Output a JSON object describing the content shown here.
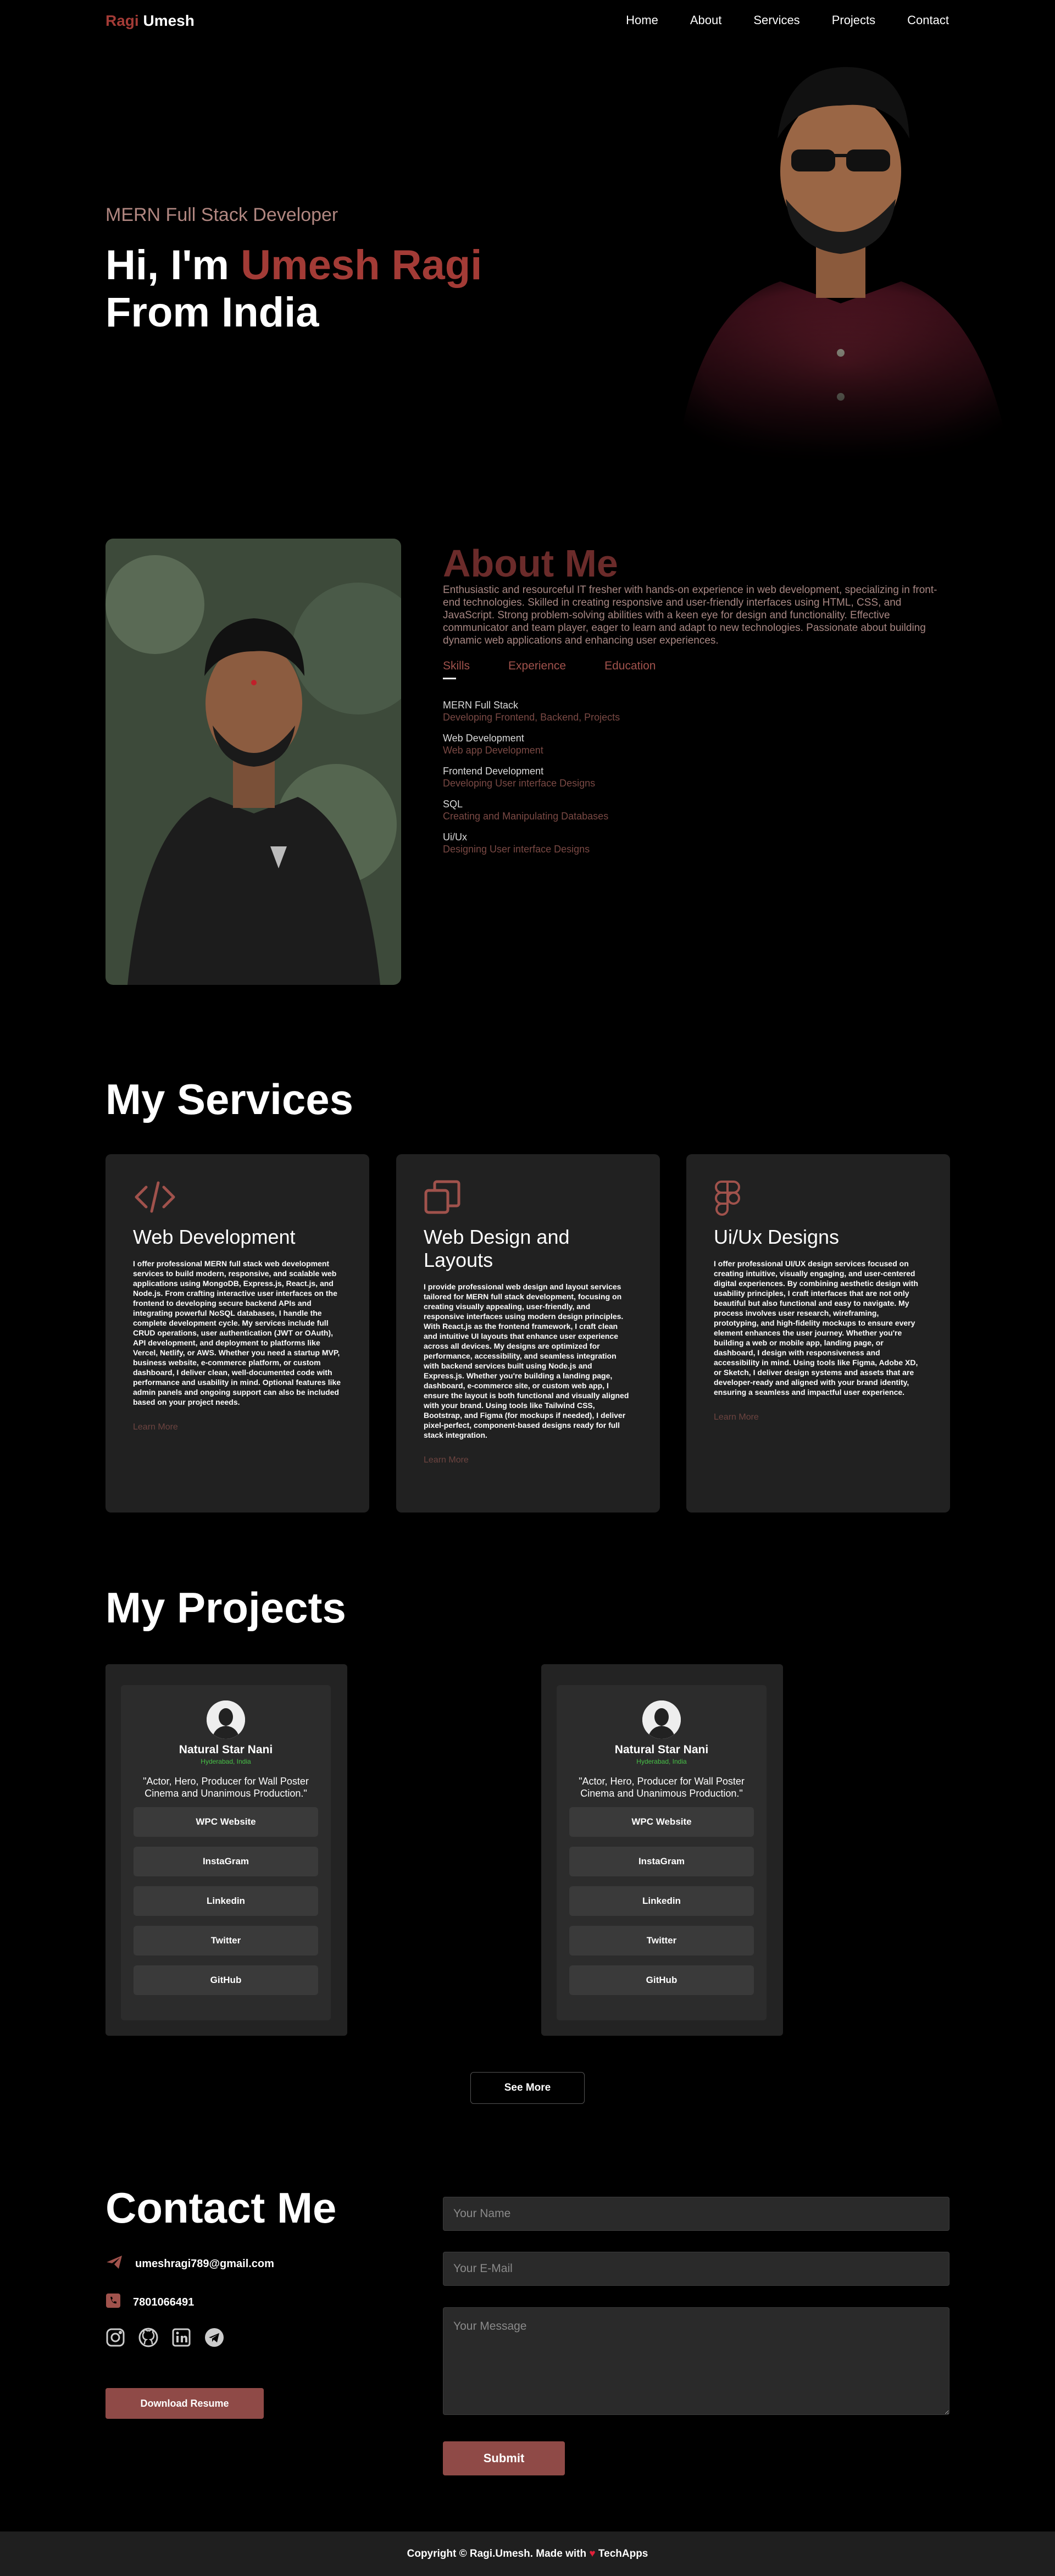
{
  "nav": {
    "brand_first": "Ragi",
    "brand_second": " Umesh",
    "links": [
      "Home",
      "About",
      "Services",
      "Projects",
      "Contact"
    ]
  },
  "hero": {
    "subtitle": "MERN Full Stack Developer",
    "greeting": "Hi, I'm ",
    "name": "Umesh Ragi",
    "origin": "From India"
  },
  "about": {
    "title": "About Me",
    "description": "Enthusiastic and resourceful IT fresher with hands-on experience in web development, specializing in front-end technologies. Skilled in creating responsive and user-friendly interfaces using HTML, CSS, and JavaScript. Strong problem-solving abilities with a keen eye for design and functionality. Effective communicator and team player, eager to learn and adapt to new technologies. Passionate about building dynamic web applications and enhancing user experiences.",
    "tabs": [
      "Skills",
      "Experience",
      "Education"
    ],
    "skills": [
      {
        "name": "MERN Full Stack",
        "desc": "Developing Frontend, Backend, Projects"
      },
      {
        "name": "Web Development",
        "desc": "Web app Development"
      },
      {
        "name": "Frontend Development",
        "desc": "Developing User interface Designs"
      },
      {
        "name": "SQL",
        "desc": "Creating and Manipulating Databases"
      },
      {
        "name": "Ui/Ux",
        "desc": "Designing User interface Designs"
      }
    ]
  },
  "services": {
    "title": "My Services",
    "learn_more": "Learn More",
    "cards": [
      {
        "icon": "code-icon",
        "name": "Web Development",
        "text": "I offer professional MERN full stack web development services to build modern, responsive, and scalable web applications using MongoDB, Express.js, React.js, and Node.js. From crafting interactive user interfaces on the frontend to developing secure backend APIs and integrating powerful NoSQL databases, I handle the complete development cycle. My services include full CRUD operations, user authentication (JWT or OAuth), API development, and deployment to platforms like Vercel, Netlify, or AWS. Whether you need a startup MVP, business website, e-commerce platform, or custom dashboard, I deliver clean, well-documented code with performance and usability in mind. Optional features like admin panels and ongoing support can also be included based on your project needs."
      },
      {
        "icon": "layers-icon",
        "name": "Web Design and Layouts",
        "text": "I provide professional web design and layout services tailored for MERN full stack development, focusing on creating visually appealing, user-friendly, and responsive interfaces using modern design principles. With React.js as the frontend framework, I craft clean and intuitive UI layouts that enhance user experience across all devices. My designs are optimized for performance, accessibility, and seamless integration with backend services built using Node.js and Express.js. Whether you're building a landing page, dashboard, e-commerce site, or custom web app, I ensure the layout is both functional and visually aligned with your brand. Using tools like Tailwind CSS, Bootstrap, and Figma (for mockups if needed), I deliver pixel-perfect, component-based designs ready for full stack integration."
      },
      {
        "icon": "figma-icon",
        "name": "Ui/Ux Designs",
        "text": "I offer professional UI/UX design services focused on creating intuitive, visually engaging, and user-centered digital experiences. By combining aesthetic design with usability principles, I craft interfaces that are not only beautiful but also functional and easy to navigate. My process involves user research, wireframing, prototyping, and high-fidelity mockups to ensure every element enhances the user journey. Whether you're building a web or mobile app, landing page, or dashboard, I design with responsiveness and accessibility in mind. Using tools like Figma, Adobe XD, or Sketch, I deliver design systems and assets that are developer-ready and aligned with your brand identity, ensuring a seamless and impactful user experience."
      }
    ]
  },
  "projects": {
    "title": "My Projects",
    "see_more": "See More",
    "items": [
      {
        "name": "Natural Star Nani",
        "location": "Hyderabad, India",
        "quote": "\"Actor, Hero, Producer for Wall Poster Cinema and Unanimous Production.\"",
        "buttons": [
          "WPC Website",
          "InstaGram",
          "Linkedin",
          "Twitter",
          "GitHub"
        ]
      },
      {
        "name": "Natural Star Nani",
        "location": "Hyderabad, India",
        "quote": "\"Actor, Hero, Producer for Wall Poster Cinema and Unanimous Production.\"",
        "buttons": [
          "WPC Website",
          "InstaGram",
          "Linkedin",
          "Twitter",
          "GitHub"
        ]
      }
    ]
  },
  "contact": {
    "title": "Contact Me",
    "email": "umeshragi789@gmail.com",
    "phone": "7801066491",
    "download": "Download Resume",
    "name_placeholder": "Your Name",
    "email_placeholder": "Your E-Mail",
    "message_placeholder": "Your Message",
    "submit": "Submit"
  },
  "footer": {
    "prefix": "Copyright © Ragi.Umesh. Made with ",
    "heart": "♥",
    "suffix": " TechApps"
  },
  "colors": {
    "accent": "#a33b36",
    "button": "#8f4a47",
    "card": "#212121"
  }
}
